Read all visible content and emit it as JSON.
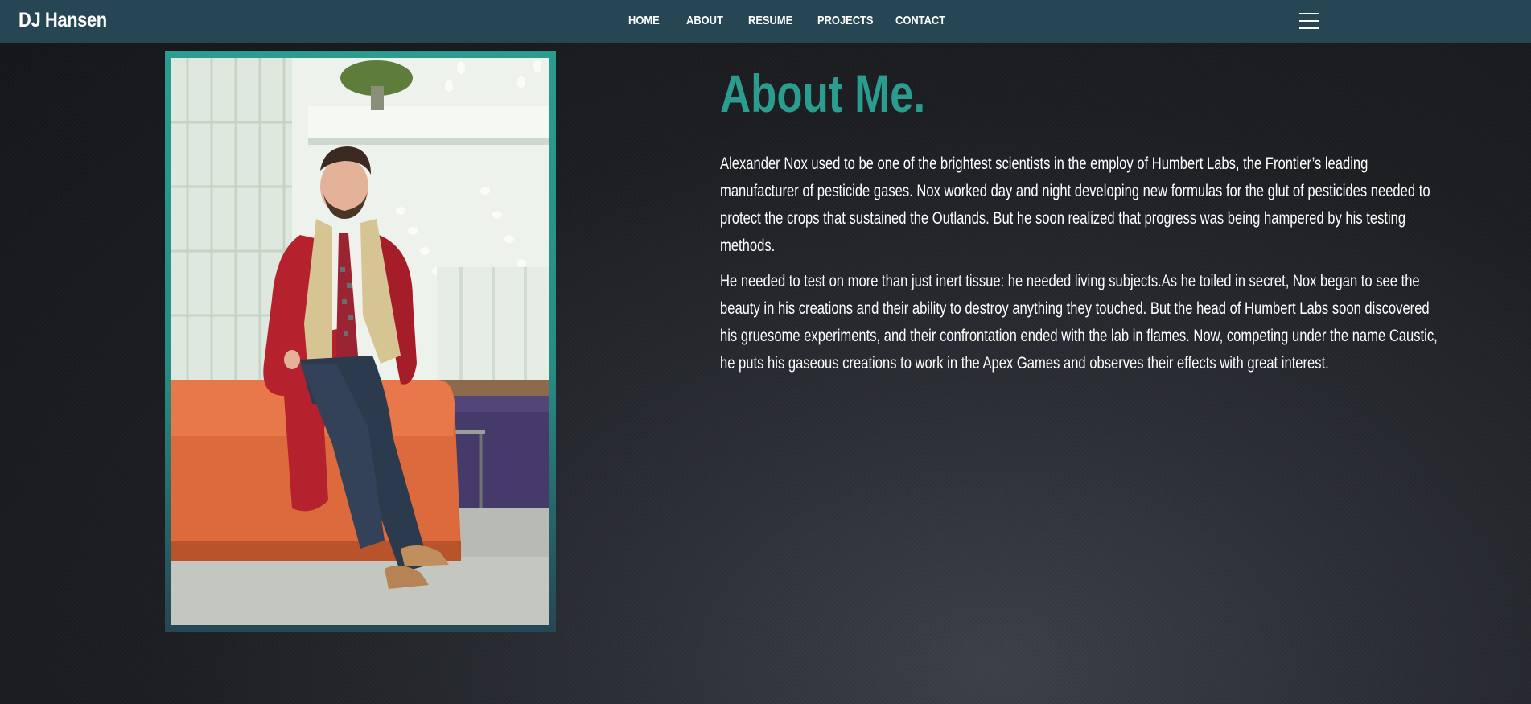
{
  "nav": {
    "brand": "DJ Hansen",
    "links": [
      {
        "label": "HOME"
      },
      {
        "label": "ABOUT"
      },
      {
        "label": "RESUME"
      },
      {
        "label": "PROJECTS"
      },
      {
        "label": "CONTACT"
      }
    ],
    "menu_icon": "hamburger-menu-icon"
  },
  "about": {
    "title": "About Me.",
    "paragraphs": [
      "Alexander Nox used to be one of the brightest scientists in the employ of Humbert Labs, the Frontier’s leading manufacturer of pesticide gases. Nox worked day and night developing new formulas for the glut of pesticides needed to protect the crops that sustained the Outlands. But he soon realized that progress was being hampered by his testing methods.",
      "He needed to test on more than just inert tissue: he needed living subjects.As he toiled in secret, Nox began to see the beauty in his creations and their ability to destroy anything they touched. But the head of Humbert Labs soon discovered his gruesome experiments, and their confrontation ended with the lab in flames. Now, competing under the name Caustic, he puts his gaseous creations to work in the Apex Games and observes their effects with great interest."
    ]
  },
  "colors": {
    "navbar": "#264653",
    "accent": "#2a9d8f",
    "text": "#ffffff",
    "background": "#1c1e22"
  }
}
